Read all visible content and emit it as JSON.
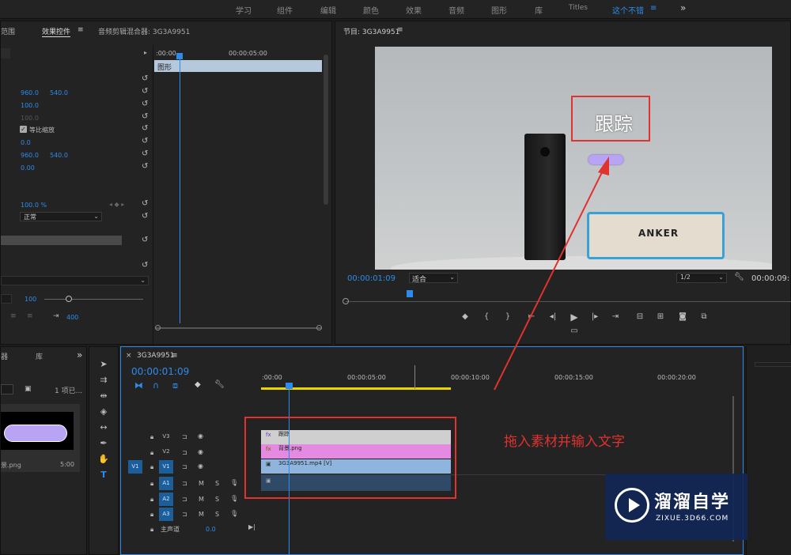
{
  "workspaces": [
    "学习",
    "组件",
    "编辑",
    "颜色",
    "效果",
    "音频",
    "图形",
    "库",
    "Titles",
    "这个不错"
  ],
  "workspace_menu_icon": "≡",
  "workspace_more": "»",
  "left_panel": {
    "tab_range": "范围",
    "tab_effect_controls": "效果控件",
    "tab_effect_menu": "≡",
    "tab_audio_mixer": "音频剪辑混合器: 3G3A9951",
    "timecode_start": ":00:00",
    "timecode_5s": "00:00:05:00",
    "graphic_label": "图形",
    "position_x": "960.0",
    "position_y": "540.0",
    "scale": "100.0",
    "scale_width": "100.0",
    "uniform_scale_label": "等比缩放",
    "rotation": "0.0",
    "anchor_x": "960.0",
    "anchor_y": "540.0",
    "flicker": "0.00",
    "opacity": "100.0 %",
    "blend_mode": "正常",
    "zoom_value": "100",
    "tracking_value": "400"
  },
  "program_monitor": {
    "title": "节目: 3G3A9951",
    "title_menu": "≡",
    "overlay_text": "跟踪",
    "product_brand": "ANKER",
    "timecode": "00:00:01:09",
    "fit_label": "适合",
    "resolution": "1/2",
    "duration": "00:00:09:"
  },
  "project_panel": {
    "tab_browser": "器",
    "tab_library": "库",
    "more": "»",
    "item_count": "1 项已...",
    "file_name": "景.png",
    "file_duration": "5:00"
  },
  "timeline": {
    "close": "×",
    "title": "3G3A9951",
    "title_menu": "≡",
    "timecode": "00:00:01:09",
    "ruler": [
      ":00:00",
      "00:00:05:00",
      "00:00:10:00",
      "00:00:15:00",
      "00:00:20:00"
    ],
    "tracks": [
      {
        "name": "V3",
        "clip": "跟踪",
        "fx": "fx",
        "color": "#cfcfcf"
      },
      {
        "name": "V2",
        "clip": "背景.png",
        "fx": "fx",
        "color": "#e48ae0"
      },
      {
        "name": "V1",
        "clip": "3G3A9951.mp4 [V]",
        "fx": "▣",
        "color": "#8fb4de"
      },
      {
        "name": "A1",
        "clip": "",
        "fx": "",
        "color": "#2f4a66"
      },
      {
        "name": "A2",
        "clip": "",
        "fx": "",
        "color": ""
      },
      {
        "name": "A3",
        "clip": "",
        "fx": "",
        "color": ""
      }
    ],
    "source_patch": "V1",
    "track_mute": "M",
    "track_solo": "S",
    "master_label": "主声道",
    "master_value": "0.0"
  },
  "annotation": {
    "text": "拖入素材并输入文字",
    "color": "#e0322f"
  },
  "watermark": {
    "title": "溜溜自学",
    "url": "ZIXUE.3D66.COM"
  }
}
